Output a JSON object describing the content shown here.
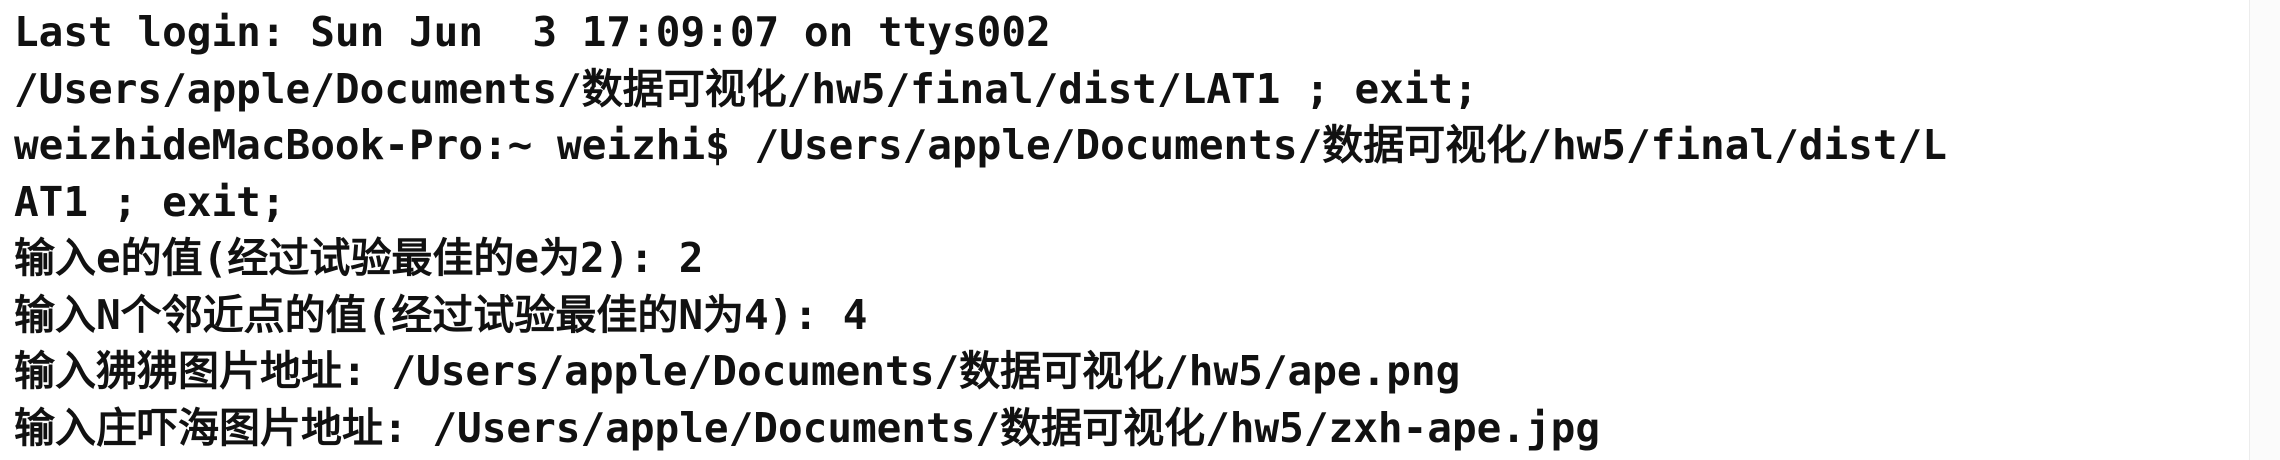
{
  "terminal": {
    "lines": [
      "Last login: Sun Jun  3 17:09:07 on ttys002",
      "/Users/apple/Documents/数据可视化/hw5/final/dist/LAT1 ; exit;",
      "weizhideMacBook-Pro:~ weizhi$ /Users/apple/Documents/数据可视化/hw5/final/dist/L",
      "AT1 ; exit;",
      "输入e的值(经过试验最佳的e为2): 2",
      "输入N个邻近点的值(经过试验最佳的N为4): 4",
      "输入狒狒图片地址: /Users/apple/Documents/数据可视化/hw5/ape.png",
      "输入庄吓海图片地址: /Users/apple/Documents/数据可视化/hw5/zxh-ape.jpg"
    ]
  },
  "colors": {
    "background": "#ffffff",
    "text": "#111111"
  }
}
